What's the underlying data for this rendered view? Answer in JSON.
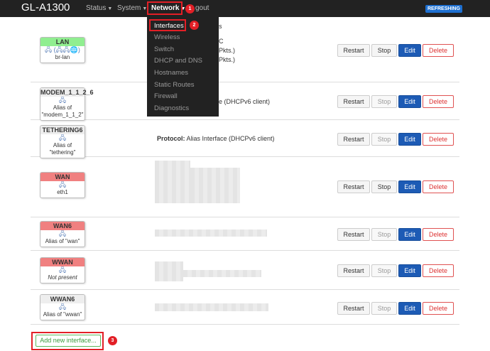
{
  "header": {
    "brand": "GL-A1300",
    "nav": {
      "status": "Status",
      "system": "System",
      "network": "Network",
      "logout_partial": "gout"
    },
    "refreshing_badge": "REFRESHING"
  },
  "network_menu": {
    "items": [
      "Interfaces",
      "Wireless",
      "Switch",
      "DHCP and DNS",
      "Hostnames",
      "Static Routes",
      "Firewall",
      "Diagnostics"
    ]
  },
  "callouts": [
    "1",
    "2",
    "3"
  ],
  "interfaces": [
    {
      "name": "LAN",
      "device": "br-lan",
      "info_lines": [
        "s",
        "C",
        "Pkts.)",
        "Pkts.)"
      ]
    },
    {
      "name": "MODEM_1_1_2_6",
      "device": "Alias of \"modem_1_1_2\"",
      "info": "e (DHCPv6 client)"
    },
    {
      "name": "TETHERING6",
      "device": "Alias of \"tethering\"",
      "info_label": "Protocol:",
      "info_value": "Alias Interface (DHCPv6 client)"
    },
    {
      "name": "WAN",
      "device": "eth1"
    },
    {
      "name": "WAN6",
      "device": "Alias of \"wan\""
    },
    {
      "name": "WWAN",
      "device": "Not present"
    },
    {
      "name": "WWAN6",
      "device": "Alias of \"wwan\""
    }
  ],
  "buttons": {
    "restart": "Restart",
    "stop": "Stop",
    "edit": "Edit",
    "delete": "Delete"
  },
  "add_interface_label": "Add new interface...",
  "icons": {
    "bridge": "network-bridge-icon",
    "ethernet": "ethernet-port-icon"
  }
}
